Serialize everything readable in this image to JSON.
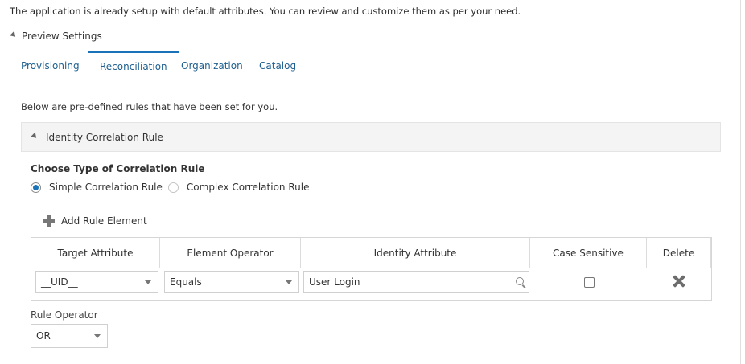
{
  "intro_text": "The application is already setup with default attributes. You can review and customize them as per your need.",
  "preview_settings": {
    "label": "Preview Settings"
  },
  "tabs": [
    {
      "label": "Provisioning",
      "active": false
    },
    {
      "label": "Reconciliation",
      "active": true
    },
    {
      "label": "Organization",
      "active": false
    },
    {
      "label": "Catalog",
      "active": false
    }
  ],
  "rules_intro": "Below are pre-defined rules that have been set for you.",
  "section": {
    "title": "Identity Correlation Rule"
  },
  "correlation_type": {
    "heading": "Choose Type of Correlation Rule",
    "options": [
      {
        "label": "Simple Correlation Rule",
        "selected": true
      },
      {
        "label": "Complex Correlation Rule",
        "selected": false
      }
    ]
  },
  "add_rule_element": {
    "label": "Add Rule Element"
  },
  "table": {
    "headers": [
      "Target Attribute",
      "Element Operator",
      "Identity Attribute",
      "Case Sensitive",
      "Delete"
    ],
    "rows": [
      {
        "target_attribute": "__UID__",
        "element_operator": "Equals",
        "identity_attribute": "User Login",
        "case_sensitive": false
      }
    ]
  },
  "rule_operator": {
    "label": "Rule Operator",
    "value": "OR"
  },
  "colors": {
    "accent": "#1a73b8",
    "link": "#1e5f8f"
  }
}
